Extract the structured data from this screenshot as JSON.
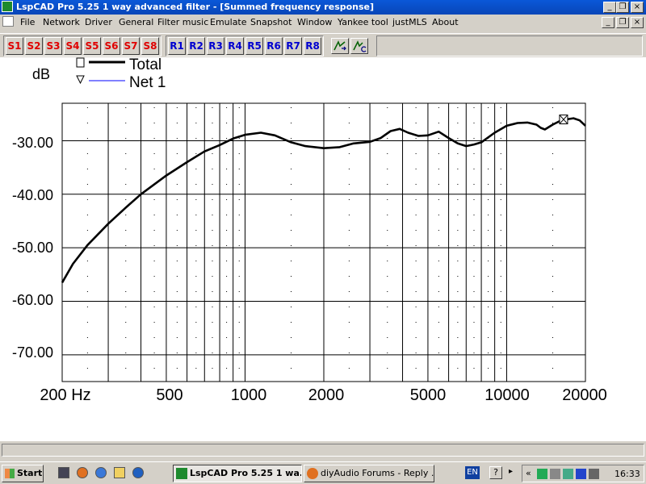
{
  "window": {
    "title": "LspCAD Pro 5.25 1 way advanced filter - [Summed frequency response]",
    "controls": {
      "minimize": "_",
      "restore": "❐",
      "close": "×"
    }
  },
  "menu": [
    "File",
    "Network",
    "Driver",
    "General",
    "Filter music",
    "Emulate",
    "Snapshot",
    "Window",
    "Yankee tool",
    "justMLS",
    "About"
  ],
  "toolbar": {
    "s_buttons": [
      "S1",
      "S2",
      "S3",
      "S4",
      "S5",
      "S6",
      "S7",
      "S8"
    ],
    "r_buttons": [
      "R1",
      "R2",
      "R3",
      "R4",
      "R5",
      "R6",
      "R7",
      "R8"
    ],
    "tool_icons": [
      "transfer-icon",
      "transfer-c-icon"
    ]
  },
  "chart_data": {
    "type": "line",
    "ylabel": "dB",
    "xscale": "log",
    "xlim": [
      200,
      20000
    ],
    "ylim": [
      -75,
      -23
    ],
    "grid": true,
    "legend_placement": "top-left",
    "x_ticks": [
      "200 Hz",
      "500",
      "1000",
      "2000",
      "5000",
      "10000",
      "20000"
    ],
    "y_ticks": [
      "-30.00",
      "-40.00",
      "-50.00",
      "-60.00",
      "-70.00"
    ],
    "series": [
      {
        "name": "Total",
        "color": "#000000",
        "marker": "square",
        "x": [
          200,
          220,
          250,
          300,
          350,
          400,
          500,
          600,
          700,
          800,
          900,
          1000,
          1150,
          1300,
          1500,
          1700,
          2000,
          2300,
          2600,
          3000,
          3300,
          3600,
          3900,
          4200,
          4600,
          5000,
          5500,
          6000,
          6500,
          7000,
          7500,
          8000,
          9000,
          10000,
          11000,
          12000,
          13000,
          13500,
          14000,
          15000,
          16000,
          17000,
          18000,
          19000,
          20000
        ],
        "y": [
          -56.5,
          -53.0,
          -49.5,
          -45.5,
          -42.5,
          -40.0,
          -36.5,
          -34.0,
          -32.0,
          -30.8,
          -29.6,
          -28.9,
          -28.5,
          -29.0,
          -30.3,
          -31.0,
          -31.4,
          -31.2,
          -30.5,
          -30.2,
          -29.5,
          -28.2,
          -27.8,
          -28.5,
          -29.1,
          -29.0,
          -28.3,
          -29.5,
          -30.5,
          -31.0,
          -30.7,
          -30.3,
          -28.5,
          -27.2,
          -26.7,
          -26.6,
          -27.0,
          -27.6,
          -27.9,
          -27.0,
          -26.3,
          -26.0,
          -25.8,
          -26.2,
          -27.2
        ]
      },
      {
        "name": "Net 1",
        "color": "#0000ff",
        "marker": "triangle",
        "x": [],
        "y": []
      }
    ]
  },
  "statusbar": {
    "text": ""
  },
  "taskbar": {
    "start_label": "Start",
    "quick_launch": [
      "show-desktop-icon",
      "firefox-icon",
      "ie-icon",
      "outlook-icon",
      "media-player-icon"
    ],
    "tasks": [
      {
        "label": "LspCAD Pro 5.25 1 wa...",
        "active": true
      },
      {
        "label": "diyAudio Forums - Reply ...",
        "active": false
      }
    ],
    "language": "EN",
    "help": "?",
    "tray_icons": [
      "network-icon",
      "security-icon",
      "tool-icon",
      "update-icon",
      "speaker-icon"
    ],
    "time": "16:33"
  }
}
